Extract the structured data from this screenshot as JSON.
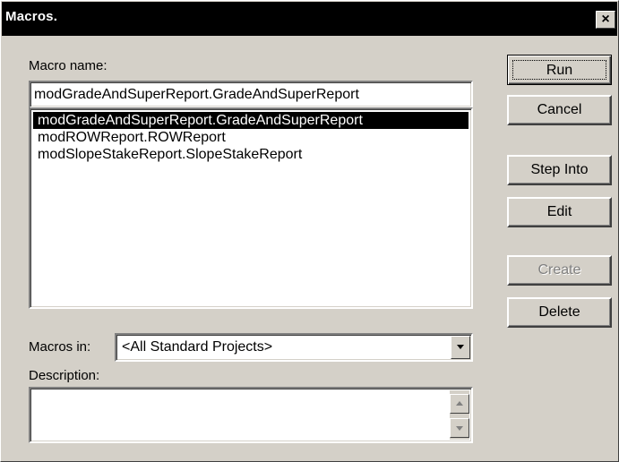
{
  "window": {
    "title": "Macros.",
    "close_symbol": "×"
  },
  "macro_name": {
    "label": "Macro name:",
    "value": "modGradeAndSuperReport.GradeAndSuperReport"
  },
  "macro_list": {
    "items": [
      "modGradeAndSuperReport.GradeAndSuperReport",
      "modROWReport.ROWReport",
      "modSlopeStakeReport.SlopeStakeReport"
    ],
    "selected_index": 0
  },
  "buttons": {
    "run": "Run",
    "cancel": "Cancel",
    "step_into": "Step Into",
    "edit": "Edit",
    "create": "Create",
    "delete": "Delete"
  },
  "macros_in": {
    "label": "Macros in:",
    "value": "<All Standard Projects>"
  },
  "description": {
    "label": "Description:",
    "value": ""
  },
  "icons": {
    "close": "close-icon",
    "dropdown": "chevron-down-icon",
    "scroll_up": "arrow-up-icon",
    "scroll_down": "arrow-down-icon"
  },
  "colors": {
    "titlebar": "#000000",
    "face": "#d4d0c8",
    "selection": "#000000",
    "disabled_text": "#808080"
  }
}
